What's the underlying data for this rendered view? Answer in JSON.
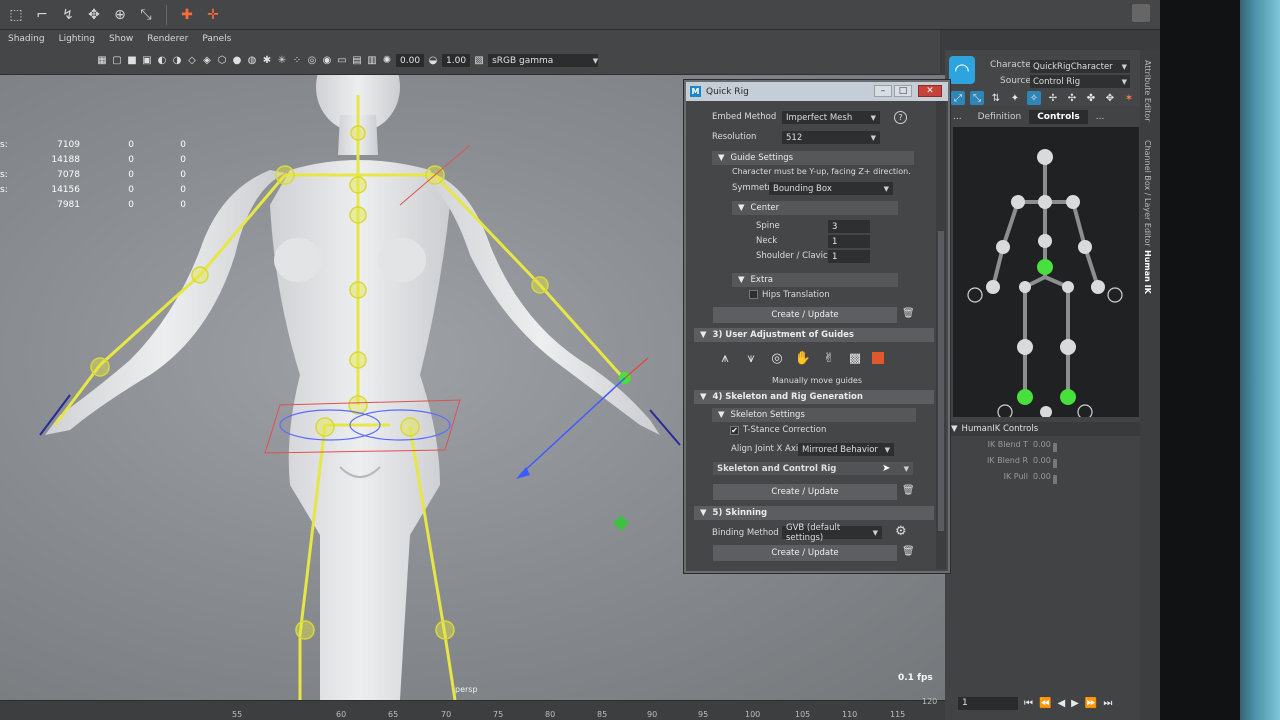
{
  "colors": {
    "accent_blue": "#2da4de",
    "stop_red": "#e0572c",
    "skeleton_yellow": "#e6e645",
    "hik_green": "#47e03c"
  },
  "viewport": {
    "menu": [
      "Shading",
      "Lighting",
      "Show",
      "Renderer",
      "Panels"
    ],
    "field_a": "0.00",
    "field_b": "1.00",
    "color_space": "sRGB gamma",
    "stats": [
      {
        "label": "s:",
        "v1": "7109",
        "v2": "0",
        "v3": "0"
      },
      {
        "label": "",
        "v1": "14188",
        "v2": "0",
        "v3": "0"
      },
      {
        "label": "s:",
        "v1": "7078",
        "v2": "0",
        "v3": "0"
      },
      {
        "label": "s:",
        "v1": "14156",
        "v2": "0",
        "v3": "0"
      },
      {
        "label": "",
        "v1": "7981",
        "v2": "0",
        "v3": "0"
      }
    ],
    "camera": "persp",
    "fps": "0.1 fps"
  },
  "timeline": {
    "ticks": [
      "55",
      "60",
      "65",
      "70",
      "75",
      "80",
      "85",
      "90",
      "95",
      "100",
      "105",
      "110",
      "115",
      "120"
    ],
    "current_frame": "1",
    "end_frame": "120"
  },
  "humanik": {
    "character_label": "Character",
    "character_value": "QuickRigCharacter",
    "source_label": "Source",
    "source_value": "Control Rig",
    "tabs": [
      "...",
      "Definition",
      "Controls",
      "..."
    ],
    "controls_title": "HumanIK Controls",
    "ik_rows": [
      {
        "label": "IK Blend T",
        "value": "0.00"
      },
      {
        "label": "IK Blend R",
        "value": "0.00"
      },
      {
        "label": "IK Pull",
        "value": "0.00"
      }
    ],
    "side_tabs": [
      "Attribute Editor",
      "Channel Box / Layer Editor",
      "Human IK"
    ]
  },
  "quick_rig": {
    "title": "Quick Rig",
    "embed_method_label": "Embed Method",
    "embed_method_value": "Imperfect Mesh",
    "resolution_label": "Resolution",
    "resolution_value": "512",
    "guide_settings": "Guide Settings",
    "guide_note": "Character must be Y-up, facing Z+ direction.",
    "symmetry_label": "Symmetry",
    "symmetry_value": "Bounding Box",
    "center": "Center",
    "spine_label": "Spine",
    "spine_value": "3",
    "neck_label": "Neck",
    "neck_value": "1",
    "shoulder_label": "Shoulder / Clavicle",
    "shoulder_value": "1",
    "extra": "Extra",
    "hips_translation": "Hips Translation",
    "create_update": "Create / Update",
    "section3": "3) User Adjustment of Guides",
    "manually_move": "Manually move guides",
    "section4": "4) Skeleton and Rig Generation",
    "skeleton_settings": "Skeleton Settings",
    "tstance": "T-Stance Correction",
    "align_label": "Align Joint X Axis",
    "align_value": "Mirrored Behavior",
    "skeleton_mode": "Skeleton and Control Rig",
    "section5": "5) Skinning",
    "binding_label": "Binding Method",
    "binding_value": "GVB (default settings)"
  }
}
